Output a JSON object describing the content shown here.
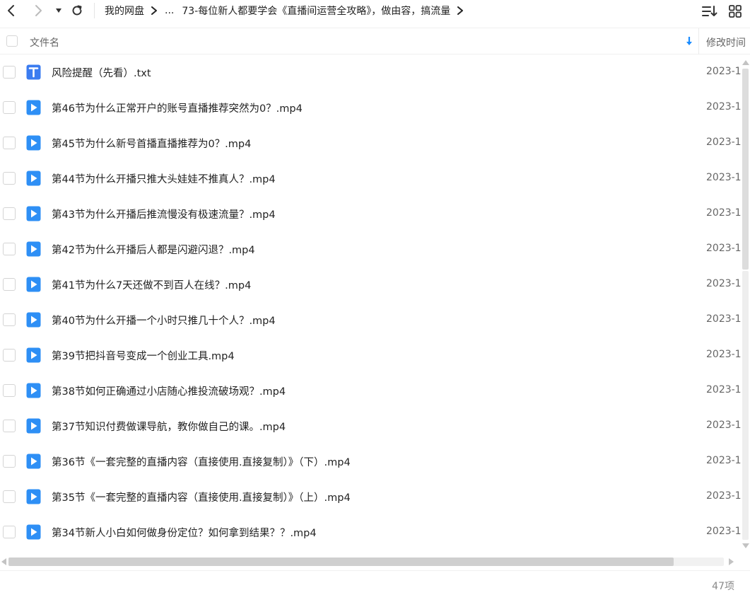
{
  "toolbar": {
    "back_icon": "chevron-left-icon",
    "forward_icon": "chevron-right-icon",
    "dropdown_icon": "caret-down-icon",
    "refresh_icon": "refresh-icon",
    "sort_icon": "sort-list-icon",
    "grid_icon": "grid-view-icon"
  },
  "breadcrumb": {
    "root": "我的网盘",
    "ellipsis": "...",
    "current": "73-每位新人都要学会《直播间运营全攻略》，做由容，搞流量"
  },
  "header": {
    "name_label": "文件名",
    "time_label": "修改时间",
    "sort_icon": "sort-down-arrow-icon",
    "accent_color": "#1a8cff"
  },
  "files": [
    {
      "name": "风险提醒（先看）.txt",
      "type": "txt",
      "time": "2023-1"
    },
    {
      "name": "第46节为什么正常开户的账号直播推荐突然为0？.mp4",
      "type": "video",
      "time": "2023-1"
    },
    {
      "name": "第45节为什么新号首播直播推荐为0？.mp4",
      "type": "video",
      "time": "2023-1"
    },
    {
      "name": "第44节为什么开播只推大头娃娃不推真人？.mp4",
      "type": "video",
      "time": "2023-1"
    },
    {
      "name": "第43节为什么开播后推流慢没有极速流量？.mp4",
      "type": "video",
      "time": "2023-1"
    },
    {
      "name": "第42节为什么开播后人都是闪避闪退？.mp4",
      "type": "video",
      "time": "2023-1"
    },
    {
      "name": "第41节为什么7天还做不到百人在线？.mp4",
      "type": "video",
      "time": "2023-1"
    },
    {
      "name": "第40节为什么开播一个小时只推几十个人？.mp4",
      "type": "video",
      "time": "2023-1"
    },
    {
      "name": "第39节把抖音号变成一个创业工具.mp4",
      "type": "video",
      "time": "2023-1"
    },
    {
      "name": "第38节如何正确通过小店随心推投流破场观？.mp4",
      "type": "video",
      "time": "2023-1"
    },
    {
      "name": "第37节知识付费做课导航，教你做自己的课。.mp4",
      "type": "video",
      "time": "2023-1"
    },
    {
      "name": "第36节《一套完整的直播内容（直接使用.直接复制）》（下）.mp4",
      "type": "video",
      "time": "2023-1"
    },
    {
      "name": "第35节《一套完整的直播内容（直接使用.直接复制）》（上）.mp4",
      "type": "video",
      "time": "2023-1"
    },
    {
      "name": "第34节新人小白如何做身份定位？如何拿到结果？？.mp4",
      "type": "video",
      "time": "2023-1"
    }
  ],
  "footer": {
    "count": "47项"
  },
  "colors": {
    "video_icon": "#2e8ff5",
    "txt_icon": "#3b7cf0"
  }
}
